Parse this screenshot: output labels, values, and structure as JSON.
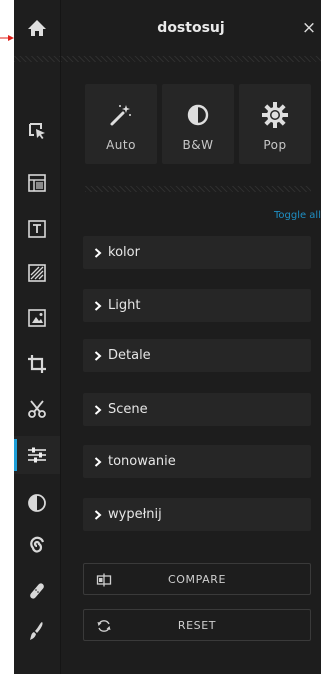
{
  "panel": {
    "title": "dostosuj",
    "close_glyph": "×"
  },
  "presets": [
    {
      "label": "Auto",
      "icon": "magic-wand-icon"
    },
    {
      "label": "B&W",
      "icon": "contrast-icon"
    },
    {
      "label": "Pop",
      "icon": "sun-gear-icon"
    }
  ],
  "toggle_all": "Toggle all",
  "sections": [
    {
      "label": "kolor"
    },
    {
      "label": "Light"
    },
    {
      "label": "Detale"
    },
    {
      "label": "Scene"
    },
    {
      "label": "tonowanie"
    },
    {
      "label": "wypełnij"
    }
  ],
  "actions": {
    "compare": "COMPARE",
    "reset": "RESET"
  },
  "rail": {
    "active_tool": "adjust",
    "tools": [
      "home-icon",
      "select-icon",
      "layout-icon",
      "text-icon",
      "texture-icon",
      "image-icon",
      "crop-icon",
      "cutout-icon",
      "adjust-icon",
      "contrast-icon",
      "spiral-icon",
      "bandage-icon",
      "brush-icon"
    ]
  },
  "colors": {
    "accent": "#1e9fd8",
    "pointer": "#e0201a",
    "background": "#1d1d1d"
  }
}
